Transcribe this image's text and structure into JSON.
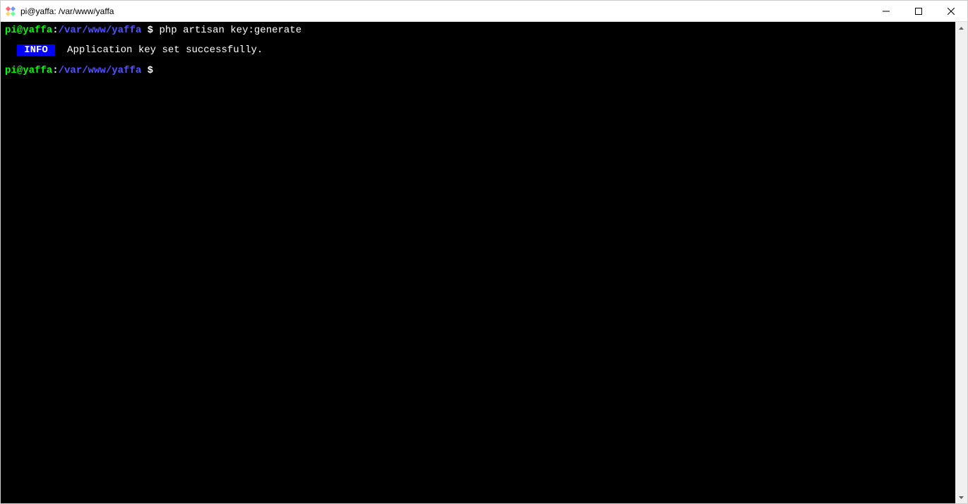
{
  "window": {
    "title": "pi@yaffa: /var/www/yaffa"
  },
  "terminal": {
    "line1": {
      "user": "pi@yaffa",
      "colon": ":",
      "path": "/var/www/yaffa",
      "prompt": " $ ",
      "command": "php artisan key:generate"
    },
    "output": {
      "indent": "  ",
      "badge_pre": " ",
      "badge": "INFO",
      "badge_post": " ",
      "message": "  Application key set successfully."
    },
    "line2": {
      "user": "pi@yaffa",
      "colon": ":",
      "path": "/var/www/yaffa",
      "prompt": " $ ",
      "command": ""
    }
  }
}
